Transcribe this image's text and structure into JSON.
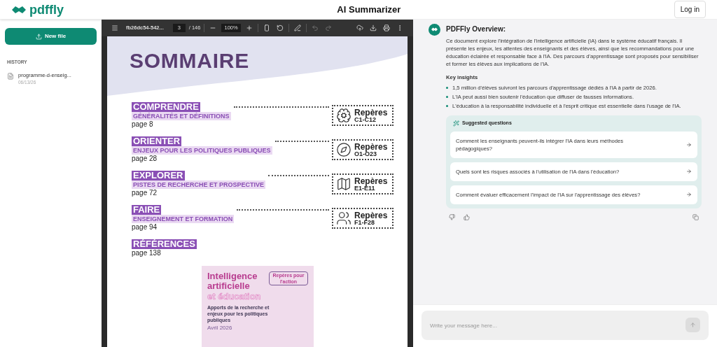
{
  "header": {
    "logo": "pdffly",
    "title": "AI Summarizer",
    "login": "Log in"
  },
  "sidebar": {
    "new_file": "New file",
    "history_label": "HISTORY",
    "history": [
      {
        "name": "programme-d-enseig...",
        "date": "06/13/26"
      }
    ]
  },
  "viewer": {
    "toolbar": {
      "filename": "fb26dc54-542...",
      "page": "3",
      "page_count": "/ 146",
      "zoom": "100%"
    },
    "page": {
      "title": "SOMMAIRE",
      "entries": [
        {
          "heading": "COMPRENDRE",
          "subtitle": "GÉNÉRALITÉS ET DÉFINITIONS",
          "page": "page 8",
          "reperes": "Repères",
          "range": "C1-C12",
          "kind": "brain"
        },
        {
          "heading": "ORIENTER",
          "subtitle": "ENJEUX POUR LES POLITIQUES PUBLIQUES",
          "page": "page 28",
          "reperes": "Repères",
          "range": "O1-O23",
          "kind": "compass"
        },
        {
          "heading": "EXPLORER",
          "subtitle": "PISTES DE RECHERCHE ET PROSPECTIVE",
          "page": "page 72",
          "reperes": "Repères",
          "range": "E1-E11",
          "kind": "map"
        },
        {
          "heading": "FAIRE",
          "subtitle": "ENSEIGNEMENT ET FORMATION",
          "page": "page 94",
          "reperes": "Repères",
          "range": "F1-F28",
          "kind": "team"
        },
        {
          "heading": "RÉFÉRENCES",
          "page": "page 138",
          "kind": "plain"
        }
      ],
      "cover": {
        "title": "Intelligence artificielle",
        "title_2": "et éducation",
        "tag": "Repères pour l'action",
        "subtitle": "Apports de la recherche et enjeux pour les politiques publiques",
        "date": "Avril 2026"
      }
    }
  },
  "chat": {
    "title": "PDFFly Overview:",
    "summary": "Ce document explore l'intégration de l'intelligence artificielle (IA) dans le système éducatif français. Il présente les enjeux, les attentes des enseignants et des élèves, ainsi que les recommandations pour une éducation éclairée et responsable face à l'IA. Des parcours d'apprentissage sont proposés pour sensibiliser et former les élèves aux implications de l'IA.",
    "insights_title": "Key insights",
    "insights": [
      "1,5 million d'élèves suivront les parcours d'apprentissage dédiés à l'IA à partir de 2026.",
      "L'IA peut aussi bien soutenir l'éducation que diffuser de fausses informations.",
      "L'éducation à la responsabilité individuelle et à l'esprit critique est essentielle dans l'usage de l'IA."
    ],
    "suggested_title": "Suggested questions",
    "questions": [
      "Comment les enseignants peuvent-ils intégrer l'IA dans leurs méthodes pédagogiques?",
      "Quels sont les risques associés à l'utilisation de l'IA dans l'éducation?",
      "Comment évaluer efficacement l'impact de l'IA sur l'apprentissage des élèves?"
    ],
    "input": {
      "placeholder": "Write your message here..."
    }
  }
}
